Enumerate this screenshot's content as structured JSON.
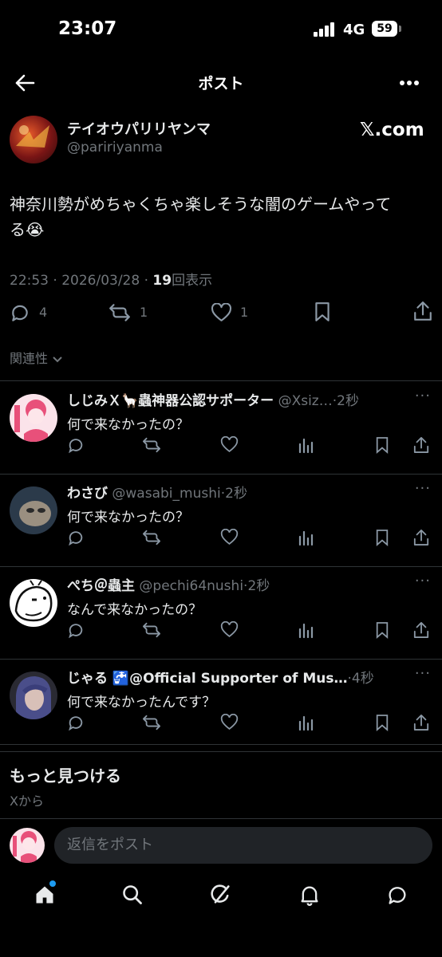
{
  "status": {
    "time": "23:07",
    "network": "4G",
    "battery": "59"
  },
  "header": {
    "title": "ポスト"
  },
  "post": {
    "author_name": "テイオウパリリヤンマ",
    "handle": "@paririyanma",
    "source_badge": "𝕏.com",
    "text_line1": "神奈川勢がめちゃくちゃ楽しそうな闇のゲームやって",
    "text_line2": "る😭",
    "timestamp": "22:53 · 2026/03/28 · ",
    "views_count": "19",
    "views_label": "回表示",
    "replies": "4",
    "reposts": "1",
    "likes": "1"
  },
  "filter": {
    "label": "関連性"
  },
  "replies": [
    {
      "name": "しじみＸ🦙蟲神器公認サポーター",
      "handle": "@Xsiz…",
      "time": "2秒",
      "text": "何で来なかったの？"
    },
    {
      "name": "わさび",
      "handle": "@wasabi_mushi",
      "time": "2秒",
      "text": "何で来なかったの？"
    },
    {
      "name": "ぺち＠蟲主",
      "handle": "@pechi64nushi",
      "time": "2秒",
      "text": "なんで来なかったの？"
    },
    {
      "name": "じゃる 🚰@Official Supporter of Mus…",
      "handle": "",
      "time": "4秒",
      "text": "何で来なかったんです？"
    }
  ],
  "discover": {
    "title": "もっと見つける",
    "subtitle": "Xから"
  },
  "compose": {
    "placeholder": "返信をポスト"
  },
  "colors": {
    "background": "#000000",
    "muted": "#71767b",
    "accent": "#1d9bf0",
    "text": "#e7e9ea"
  }
}
